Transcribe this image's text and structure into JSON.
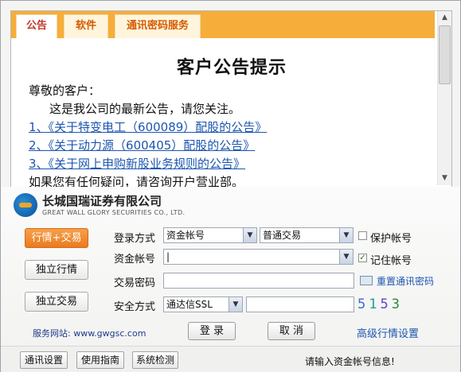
{
  "notice": {
    "tabs": [
      "公告",
      "软件",
      "通讯密码服务"
    ],
    "title": "客户公告提示",
    "greeting": "尊敬的客户：",
    "intro": "这是我公司的最新公告，请您关注。",
    "links": [
      "1、《关于特变电工（600089）配股的公告》",
      "2、《关于动力源（600405）配股的公告》",
      "3、《关于网上申购新股业务规则的公告》"
    ],
    "footer": "如果您有任何疑问，请咨询开户营业部。"
  },
  "logo": {
    "name_cn": "长城国瑞证券有限公司",
    "name_en": "GREAT WALL GLORY SECURITIES CO., LTD."
  },
  "side_buttons": [
    "行情+交易",
    "独立行情",
    "独立交易"
  ],
  "form": {
    "login_method_label": "登录方式",
    "login_method_value": "资金帐号",
    "trade_type_value": "普通交易",
    "protect_account_label": "保护帐号",
    "protect_account_checked": false,
    "account_label": "资金帐号",
    "account_value": "",
    "remember_account_label": "记住帐号",
    "remember_account_checked": true,
    "password_label": "交易密码",
    "reset_comm_password": "重置通讯密码",
    "security_label": "安全方式",
    "security_value": "通达信SSL",
    "captcha": [
      "5",
      "1",
      "5",
      "3"
    ]
  },
  "service_site": "服务网站: www.gwgsc.com",
  "buttons": {
    "login": "登 录",
    "cancel": "取 消",
    "advanced": "高级行情设置"
  },
  "bottom": {
    "buttons": [
      "通讯设置",
      "使用指南",
      "系统检测"
    ],
    "status": "请输入资金帐号信息!"
  },
  "colors": {
    "accent": "#f6ad3a",
    "link": "#1d56b0"
  }
}
